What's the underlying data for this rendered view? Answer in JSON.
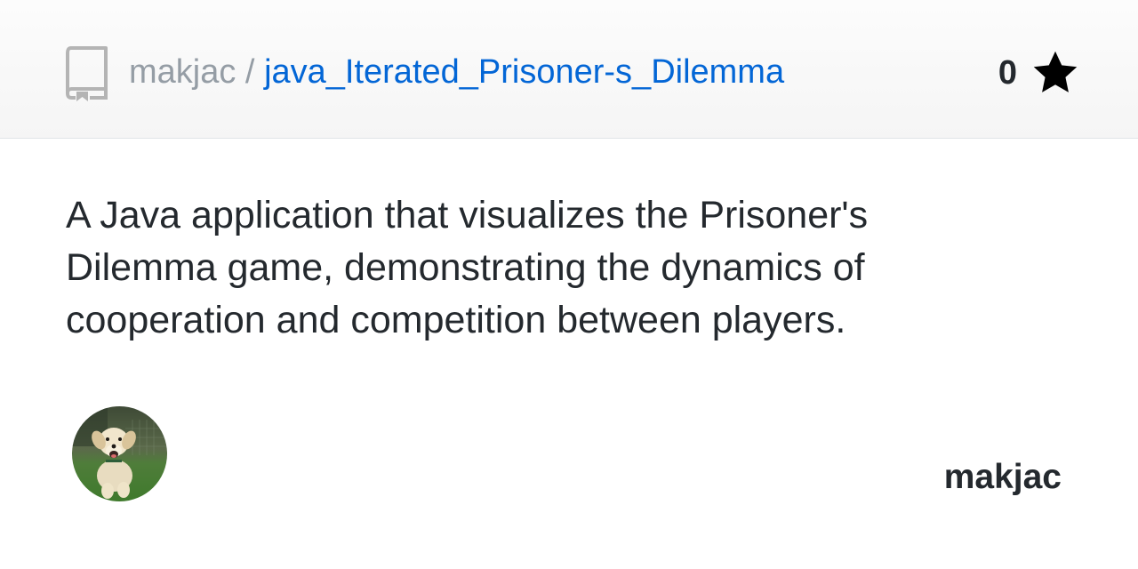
{
  "header": {
    "owner": "makjac",
    "separator": " / ",
    "repo_name": "java_Iterated_Prisoner-s_Dilemma",
    "star_count": "0",
    "repo_icon": "repo-book-icon",
    "star_icon": "star-icon"
  },
  "description": "A Java application that visualizes the Prisoner's Dilemma game, demonstrating the dynamics of cooperation and competition between players.",
  "footer": {
    "username": "makjac",
    "avatar_alt": "puppy"
  },
  "colors": {
    "link": "#0366d6",
    "muted": "#959da5",
    "text": "#24292e",
    "header_bg": "#f7f7f7"
  }
}
